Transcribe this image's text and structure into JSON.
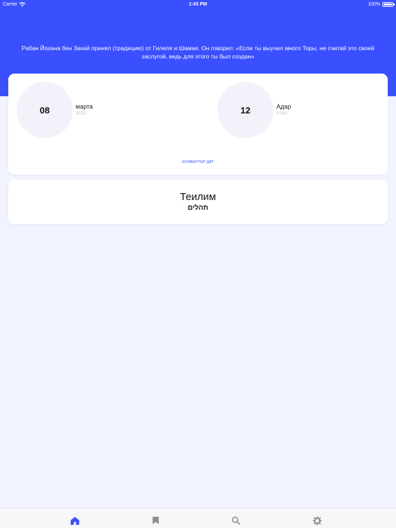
{
  "status_bar": {
    "carrier": "Carrier",
    "time": "1:43 PM",
    "battery": "100%",
    "battery_level": 1.0
  },
  "header": {
    "quote": "Рабан Йохана бен Закай принял (традицию) от Гилеля и Шамая. Он говорил: «Если ты выучил много Торы, не считай это своей заслугой, ведь для этого ты был создан»"
  },
  "date_card": {
    "gregorian": {
      "day": "08",
      "month": "марта",
      "year": "2020"
    },
    "hebrew": {
      "day": "12",
      "month": "Адар",
      "year": "5780"
    },
    "converter_label": "Конвертер дат"
  },
  "tehillim_card": {
    "title": "Теилим",
    "subtitle": "תהלים"
  },
  "tab_bar": {
    "active_tab": "home",
    "tabs": [
      {
        "id": "home",
        "icon": "home-icon"
      },
      {
        "id": "bookmarks",
        "icon": "bookmark-icon"
      },
      {
        "id": "search",
        "icon": "search-icon"
      },
      {
        "id": "settings",
        "icon": "gear-icon"
      }
    ]
  },
  "colors": {
    "accent": "#3a50ff",
    "background": "#f1f3ff",
    "card": "#ffffff",
    "inactive_icon": "#8e8e93"
  }
}
